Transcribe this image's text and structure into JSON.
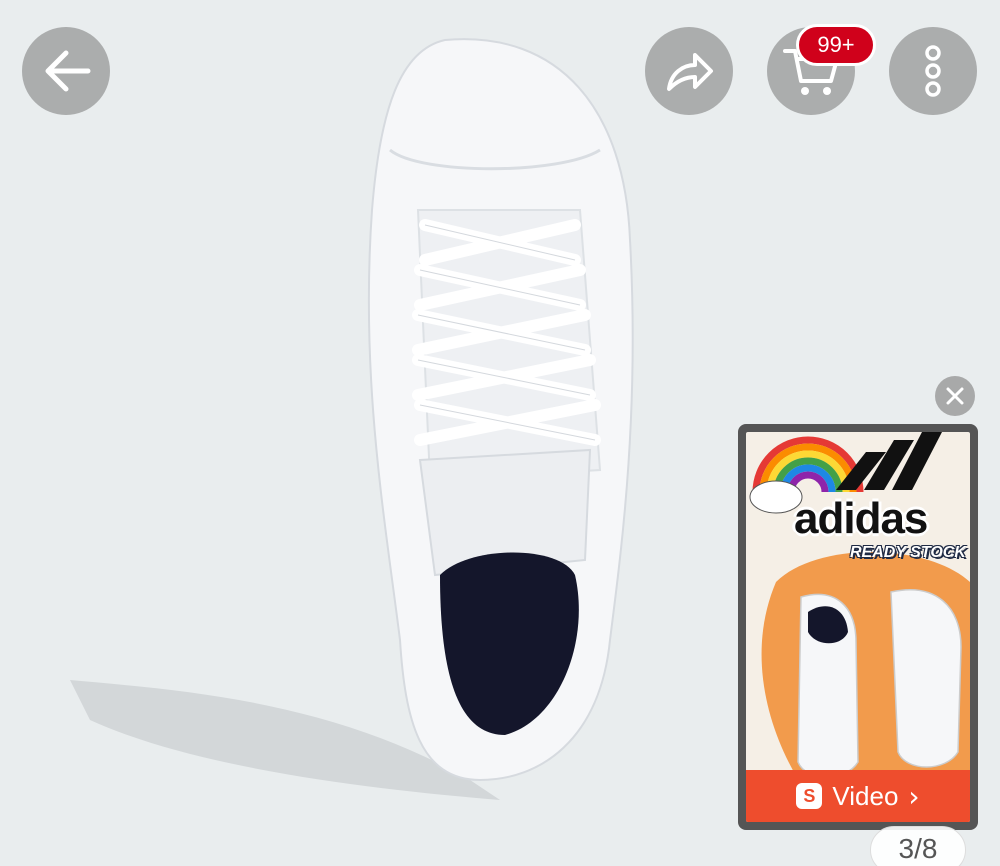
{
  "header": {
    "back_icon": "arrow-left-icon",
    "share_icon": "share-icon",
    "cart_icon": "cart-icon",
    "cart_badge": "99+",
    "more_icon": "more-vertical-icon"
  },
  "video_preview": {
    "close_icon": "close-icon",
    "brand_text": "adidas",
    "subtitle": "READY STOCK",
    "video_label": "Video",
    "video_icon": "shopee-video-icon",
    "chevron_icon": "chevron-right-icon"
  },
  "gallery": {
    "image": "white-sneaker-product-photo",
    "counter": "3/8"
  },
  "colors": {
    "badge": "#d0011b",
    "video_bar": "#ee4d2d",
    "background": "#e9edee"
  }
}
